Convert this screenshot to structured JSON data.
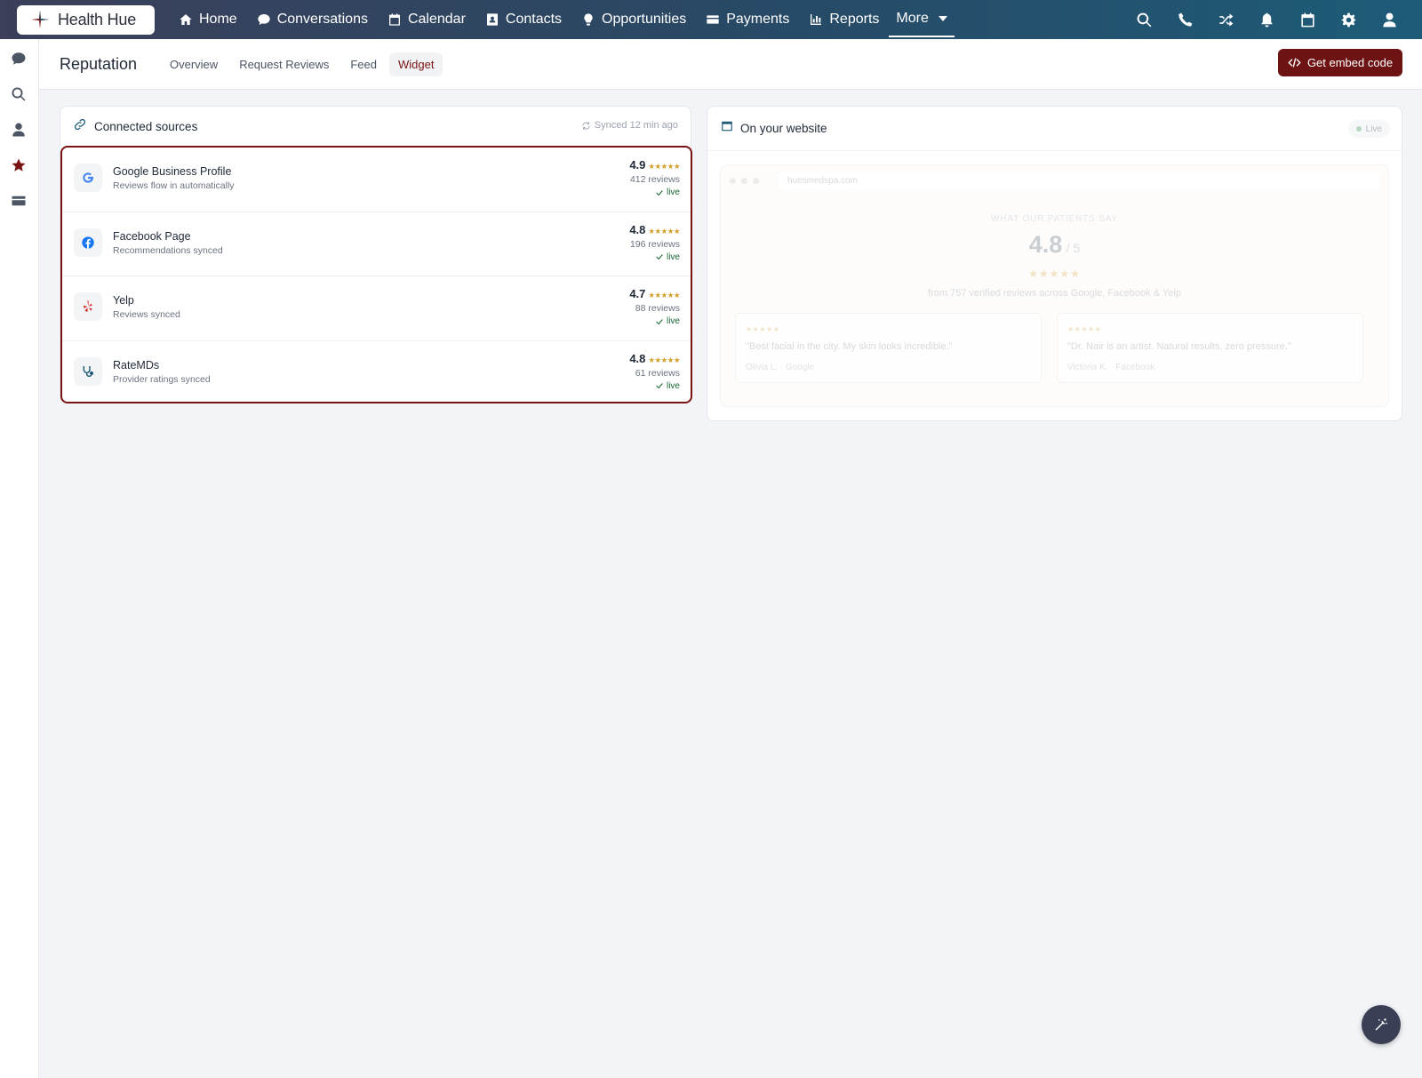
{
  "brand": {
    "name": "Health Hue"
  },
  "nav": {
    "items": [
      {
        "label": "Home",
        "icon": "home-icon"
      },
      {
        "label": "Conversations",
        "icon": "chat-icon"
      },
      {
        "label": "Calendar",
        "icon": "calendar-icon"
      },
      {
        "label": "Contacts",
        "icon": "contact-card-icon"
      },
      {
        "label": "Opportunities",
        "icon": "lightbulb-icon"
      },
      {
        "label": "Payments",
        "icon": "credit-card-icon"
      },
      {
        "label": "Reports",
        "icon": "bar-chart-icon"
      }
    ],
    "more_label": "More",
    "right_icons": [
      "search-icon",
      "phone-icon",
      "shuffle-icon",
      "bell-icon",
      "calendar-icon",
      "gear-icon",
      "user-icon"
    ]
  },
  "rail": {
    "icons": [
      "chat-icon",
      "search-icon",
      "user-icon",
      "star-icon",
      "card-icon"
    ],
    "active": "star-icon"
  },
  "subheader": {
    "title": "Reputation",
    "tabs": [
      "Overview",
      "Request Reviews",
      "Feed",
      "Widget"
    ],
    "active_tab": "Widget",
    "embed_button": "Get embed code"
  },
  "sources": {
    "title": "Connected sources",
    "synced": "Synced 12 min ago",
    "items": [
      {
        "name": "Google Business Profile",
        "desc": "Reviews flow in automatically",
        "score": "4.9",
        "stars": "★★★★★",
        "count": "412 reviews",
        "status": "live",
        "icon": "google-icon"
      },
      {
        "name": "Facebook Page",
        "desc": "Recommendations synced",
        "score": "4.8",
        "stars": "★★★★★",
        "count": "196 reviews",
        "status": "live",
        "icon": "facebook-icon"
      },
      {
        "name": "Yelp",
        "desc": "Reviews synced",
        "score": "4.7",
        "stars": "★★★★★",
        "count": "88 reviews",
        "status": "live",
        "icon": "yelp-icon"
      },
      {
        "name": "RateMDs",
        "desc": "Provider ratings synced",
        "score": "4.8",
        "stars": "★★★★★",
        "count": "61 reviews",
        "status": "live",
        "icon": "stethoscope-icon"
      }
    ]
  },
  "website": {
    "title": "On your website",
    "status": "Live",
    "preview": {
      "url": "huesmedspa.com",
      "eyebrow": "WHAT OUR PATIENTS SAY",
      "score": "4.8",
      "out_of": "/ 5",
      "stars": "★★★★★",
      "from": "from 757 verified reviews across Google, Facebook & Yelp",
      "reviews": [
        {
          "stars": "★★★★★",
          "quote": "\"Best facial in the city. My skin looks incredible.\"",
          "author": "Olivia L. · Google"
        },
        {
          "stars": "★★★★★",
          "quote": "\"Dr. Nair is an artist. Natural results, zero pressure.\"",
          "author": "Victoria K. · Facebook"
        }
      ]
    }
  },
  "colors": {
    "accent": "#6e1313",
    "nav_gradient_start": "#3b3f59",
    "nav_gradient_end": "#1d5b78",
    "star": "#d4a02a",
    "live": "#166534"
  }
}
